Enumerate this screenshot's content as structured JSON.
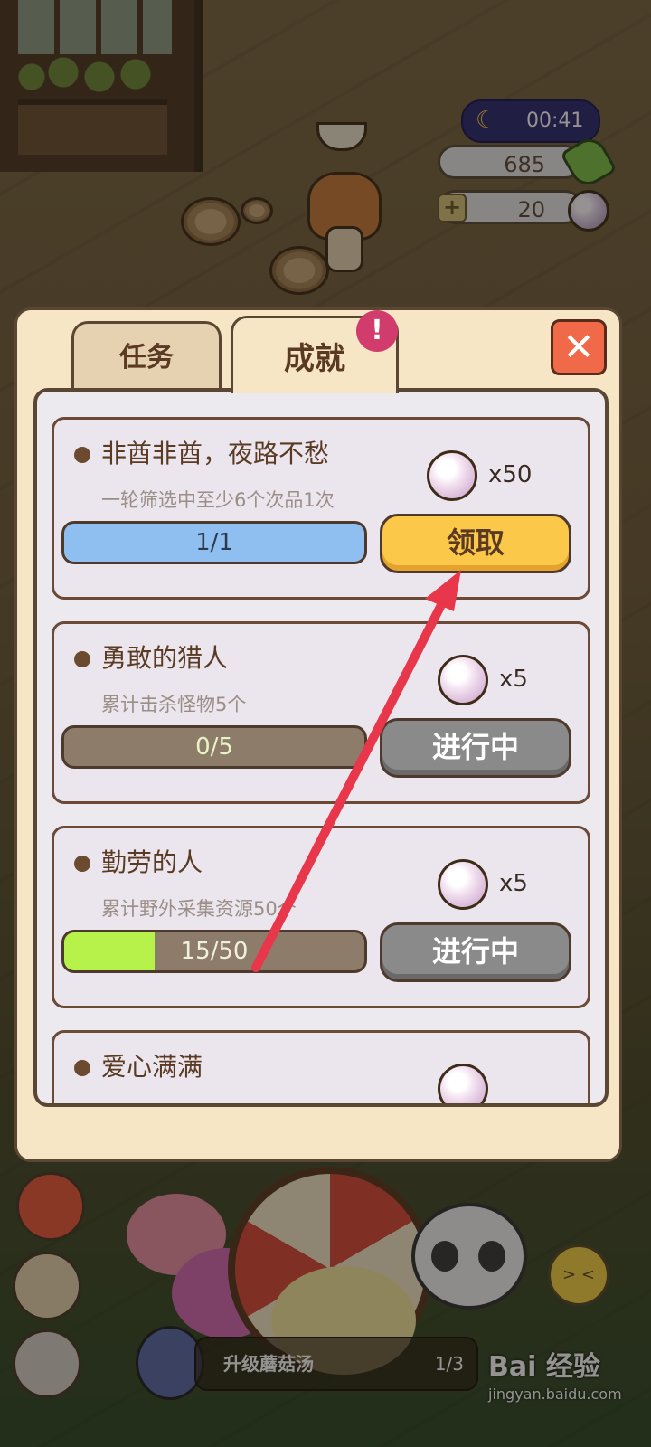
{
  "hud": {
    "time": "00:41",
    "leaves": "685",
    "pearls": "20",
    "plus": "+"
  },
  "modal": {
    "tabs": [
      {
        "label": "任务",
        "active": false
      },
      {
        "label": "成就",
        "active": true
      }
    ],
    "badge": "!",
    "close": "✕"
  },
  "achievements": [
    {
      "title": "非酋非酋，夜路不愁",
      "desc": "一轮筛选中至少6个次品1次",
      "reward_qty": "x50",
      "progress_text": "1/1",
      "progress_fraction": 1.0,
      "button": "领取",
      "state": "claimable"
    },
    {
      "title": "勇敢的猎人",
      "desc": "累计击杀怪物5个",
      "reward_qty": "x5",
      "progress_text": "0/5",
      "progress_fraction": 0.0,
      "button": "进行中",
      "state": "in-progress"
    },
    {
      "title": "勤劳的人",
      "desc": "累计野外采集资源50个",
      "reward_qty": "x5",
      "progress_text": "15/50",
      "progress_fraction": 0.3,
      "button": "进行中",
      "state": "in-progress"
    },
    {
      "title": "爱心满满",
      "desc": "",
      "reward_qty": "",
      "progress_text": "",
      "progress_fraction": 0,
      "button": "",
      "state": "partial"
    }
  ],
  "bottom": {
    "quest_name": "升级蘑菇汤",
    "quest_progress": "1/3",
    "emoji": "> <"
  },
  "watermark": {
    "main": "Bai 经验",
    "sub": "jingyan.baidu.com"
  },
  "colors": {
    "bar_claimed": "#8fbff0",
    "bar_empty": "#8e7c6a",
    "bar_fill_green": "#b6f24a",
    "claim_button": "#fcc84a",
    "progress_button": "#8a8a8a",
    "arrow": "#e8364a"
  }
}
